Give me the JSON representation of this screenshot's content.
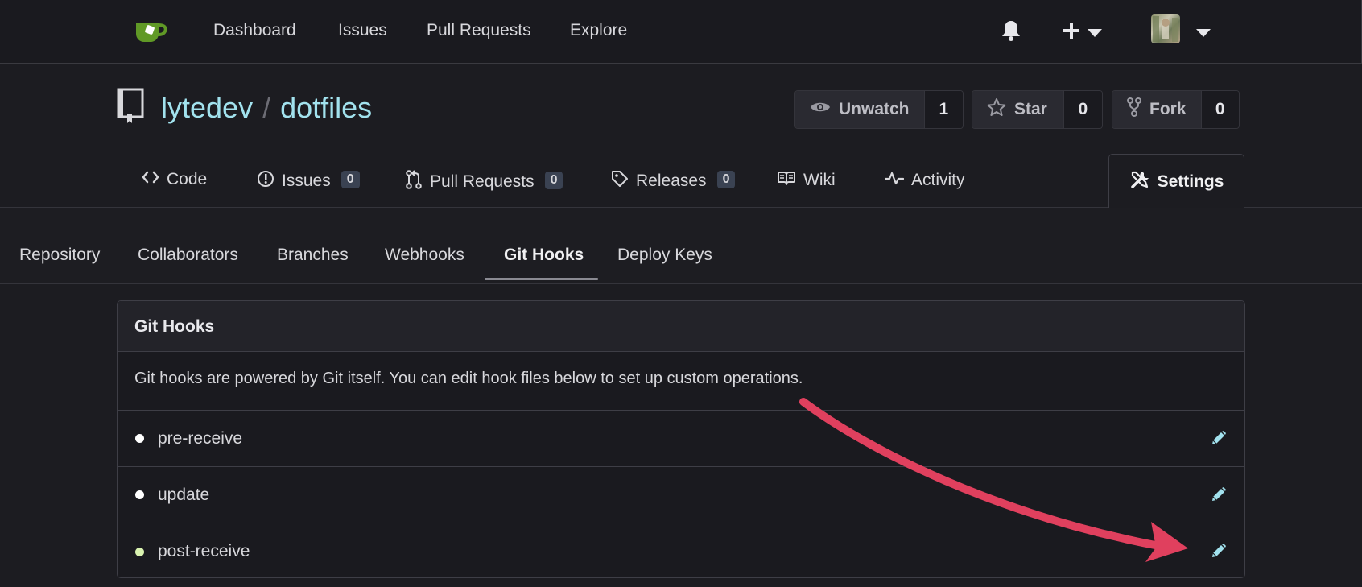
{
  "colors": {
    "link": "#a2e2ee",
    "dot_inactive": "#ffffff",
    "dot_active": "#d9f2b0",
    "arrow": "#e0405e",
    "logo": "#609926"
  },
  "nav": {
    "items": [
      "Dashboard",
      "Issues",
      "Pull Requests",
      "Explore"
    ]
  },
  "repo": {
    "owner": "lytedev",
    "separator": "/",
    "name": "dotfiles",
    "watch_label": "Unwatch",
    "watch_count": "1",
    "star_label": "Star",
    "star_count": "0",
    "fork_label": "Fork",
    "fork_count": "0"
  },
  "tabs": {
    "code": "Code",
    "issues": "Issues",
    "issues_count": "0",
    "pulls": "Pull Requests",
    "pulls_count": "0",
    "releases": "Releases",
    "releases_count": "0",
    "wiki": "Wiki",
    "activity": "Activity",
    "settings": "Settings"
  },
  "subnav": {
    "items": [
      "Repository",
      "Collaborators",
      "Branches",
      "Webhooks",
      "Git Hooks",
      "Deploy Keys"
    ],
    "active": "Git Hooks"
  },
  "panel": {
    "title": "Git Hooks",
    "description": "Git hooks are powered by Git itself. You can edit hook files below to set up custom operations.",
    "hooks": [
      {
        "name": "pre-receive",
        "active": false
      },
      {
        "name": "update",
        "active": false
      },
      {
        "name": "post-receive",
        "active": true
      }
    ]
  }
}
